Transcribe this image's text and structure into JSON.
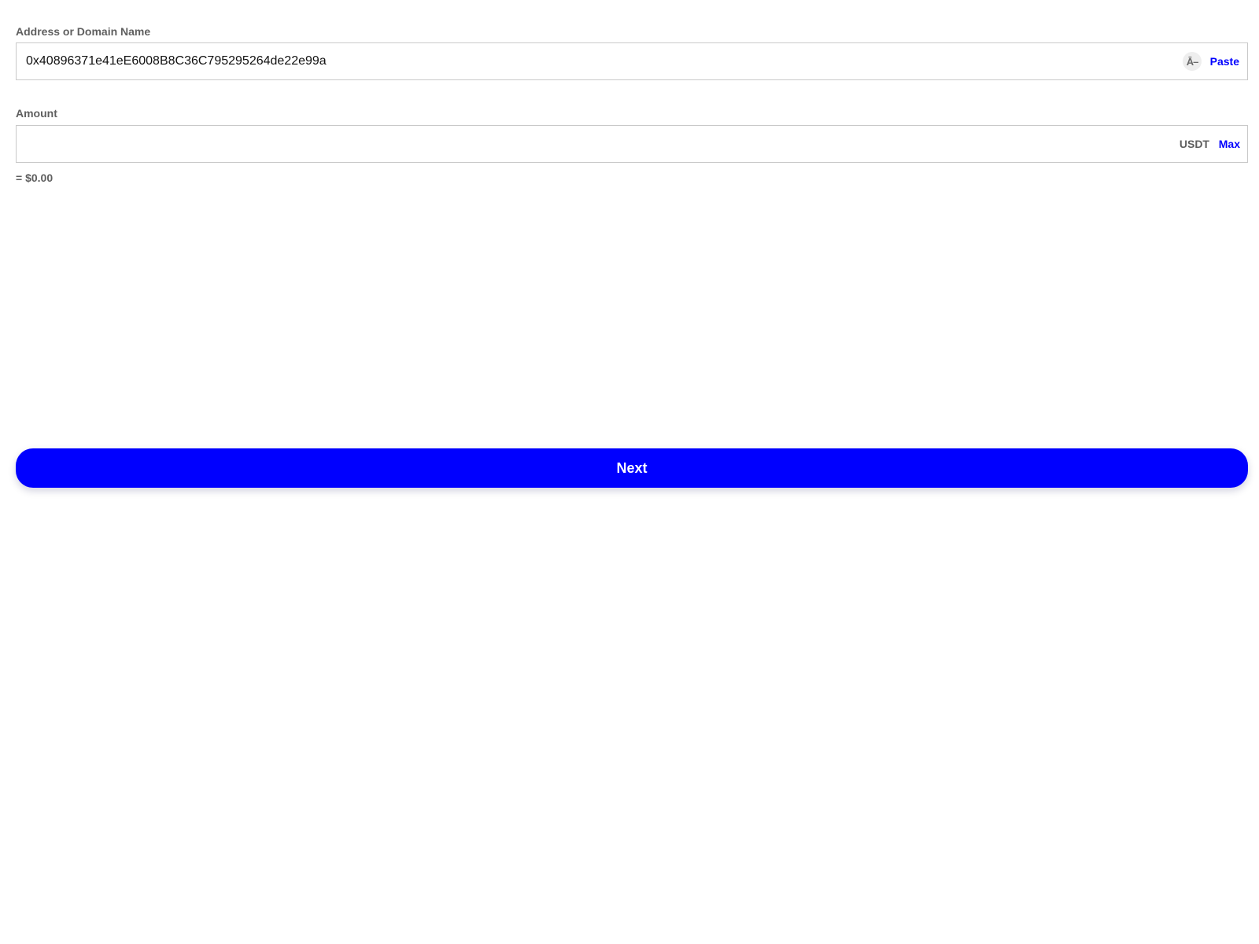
{
  "address_field": {
    "label": "Address or Domain Name",
    "value": "0x40896371e41eE6008B8C36C795295264de22e99a",
    "placeholder": "",
    "contacts_icon_glyph": "Ā–",
    "contacts_icon_name": "contacts-icon",
    "paste_label": "Paste"
  },
  "amount_field": {
    "label": "Amount",
    "value": "",
    "placeholder": "",
    "unit": "USDT",
    "max_label": "Max",
    "fiat_value": "= $0.00"
  },
  "next_button": {
    "label": "Next"
  },
  "colors": {
    "accent": "#0000ff",
    "label_gray": "#5f5f5f",
    "border": "#c9c9c9",
    "background": "#ffffff"
  }
}
